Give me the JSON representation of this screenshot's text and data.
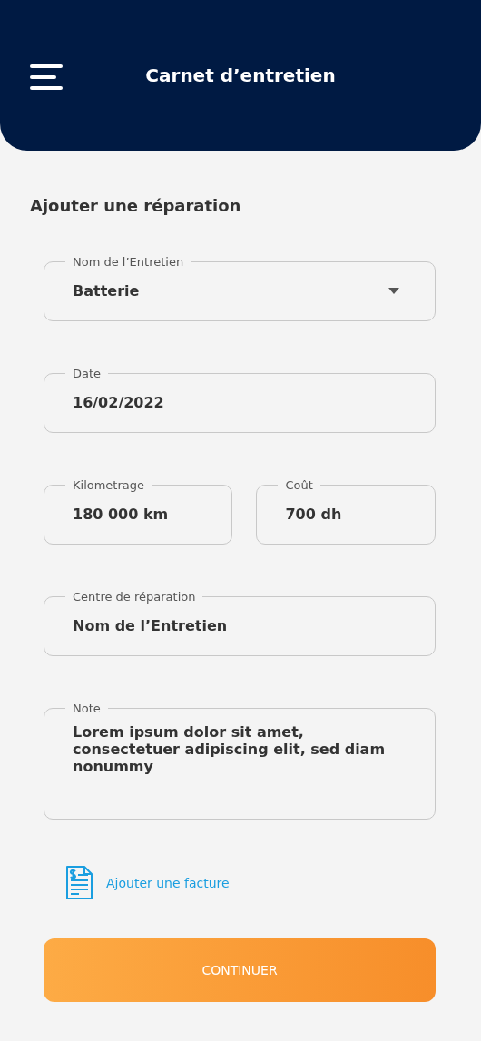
{
  "header": {
    "title": "Carnet d’entretien"
  },
  "section_title": "Ajouter une réparation",
  "fields": [
    {
      "kind": "select",
      "label": "Nom de l’Entretien",
      "value": "Batterie"
    },
    {
      "kind": "text",
      "label": "Date",
      "value": "16/02/2022"
    },
    {
      "kind": "pair",
      "items": [
        {
          "label": "Kilometrage",
          "value": "180 000 km"
        },
        {
          "label": "Coût",
          "value": "700 dh"
        }
      ]
    },
    {
      "kind": "text",
      "label": "Centre de réparation",
      "value": "Nom de l’Entretien"
    },
    {
      "kind": "textarea",
      "label": "Note",
      "value": "Lorem ipsum dolor sit amet, consectetuer adipiscing elit, sed diam nonummy"
    }
  ],
  "attachment_link": "Ajouter une facture",
  "submit_button": "CONTINUER"
}
